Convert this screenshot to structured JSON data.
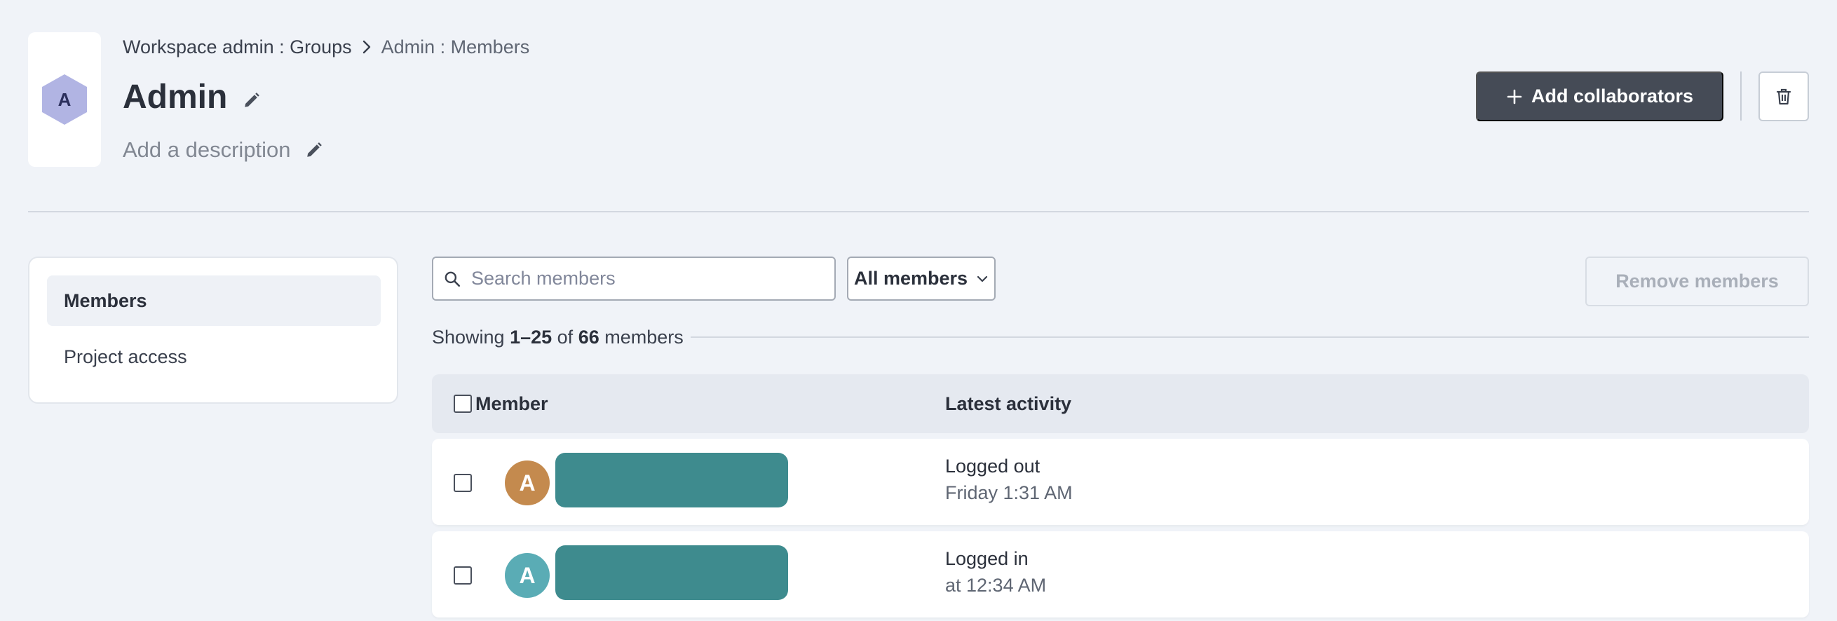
{
  "breadcrumb": {
    "parent": "Workspace admin : Groups",
    "current": "Admin : Members"
  },
  "group": {
    "initial": "A",
    "name": "Admin",
    "description_placeholder": "Add a description",
    "badge_color": "#b1b4e3"
  },
  "header_actions": {
    "add_label": "Add collaborators",
    "accent_color": "#454b56"
  },
  "sidebar": {
    "items": [
      {
        "label": "Members",
        "active": true
      },
      {
        "label": "Project access",
        "active": false
      }
    ]
  },
  "toolbar": {
    "search_placeholder": "Search members",
    "filter_label": "All members",
    "remove_label": "Remove members"
  },
  "summary": {
    "prefix": "Showing ",
    "range": "1–25",
    "of": " of ",
    "total": "66",
    "suffix": " members"
  },
  "table": {
    "columns": [
      "Member",
      "Latest activity"
    ],
    "rows": [
      {
        "avatar_initial": "A",
        "avatar_color": "#c48a4e",
        "activity": "Logged out",
        "activity_time": "Friday 1:31 AM"
      },
      {
        "avatar_initial": "A",
        "avatar_color": "#5aacb5",
        "activity": "Logged in",
        "activity_time": "at 12:34 AM"
      }
    ]
  }
}
